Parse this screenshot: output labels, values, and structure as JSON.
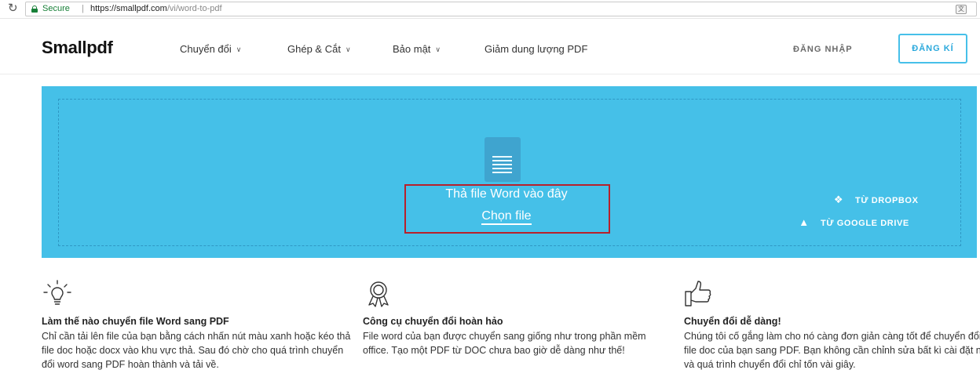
{
  "browser": {
    "secure_label": "Secure",
    "separator": "|",
    "url_host": "https://smallpdf.com",
    "url_path": "/vi/word-to-pdf"
  },
  "header": {
    "logo": "Smallpdf",
    "nav": [
      {
        "label": "Chuyển đổi"
      },
      {
        "label": "Ghép & Cắt"
      },
      {
        "label": "Bảo mật"
      },
      {
        "label": "Giảm dung lượng PDF"
      }
    ],
    "login": "ĐĂNG NHẬP",
    "signup": "ĐĂNG KÍ"
  },
  "dropzone": {
    "drop_text": "Thả file Word vào đây",
    "choose_file": "Chọn file",
    "dropbox": "TỪ DROPBOX",
    "google_drive": "TỪ GOOGLE DRIVE"
  },
  "features": [
    {
      "icon": "lightbulb-icon",
      "title": "Làm thế nào chuyển file Word sang PDF",
      "body": "Chỉ cần tải lên file của bạn bằng cách nhấn nút màu xanh hoặc kéo thả file doc hoặc docx vào khu vực thả. Sau đó chờ cho quá trình chuyển đổi word sang PDF hoàn thành và tải về."
    },
    {
      "icon": "award-ribbon-icon",
      "title": "Công cụ chuyển đổi hoàn hảo",
      "body": "File word của bạn được chuyển sang giống như trong phần mềm office. Tạo một PDF từ DOC chưa bao giờ dễ dàng như thế!"
    },
    {
      "icon": "thumbs-up-icon",
      "title": "Chuyển đổi dễ dàng!",
      "body": "Chúng tôi cố gắng làm cho nó càng đơn giản càng tốt để chuyển đổi file doc của bạn sang PDF. Bạn không cần chỉnh sửa bất kì cài đặt nào và quá trình chuyển đổi chỉ tốn vài giây."
    }
  ],
  "colors": {
    "dropzone_bg": "#45c0e8",
    "accent": "#2ba9dc",
    "highlight_border": "#b8202a",
    "secure_green": "#188038"
  }
}
